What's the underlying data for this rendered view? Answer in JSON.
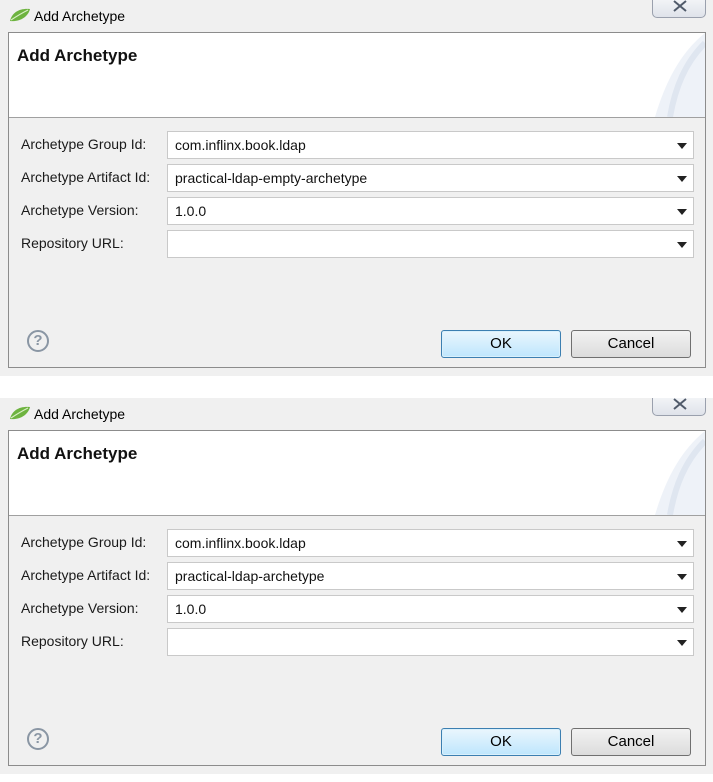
{
  "dialogs": [
    {
      "window_title": "Add Archetype",
      "banner_title": "Add Archetype",
      "fields": [
        {
          "label": "Archetype Group Id:",
          "value": "com.inflinx.book.ldap"
        },
        {
          "label": "Archetype Artifact Id:",
          "value": "practical-ldap-empty-archetype"
        },
        {
          "label": "Archetype Version:",
          "value": "1.0.0"
        },
        {
          "label": "Repository URL:",
          "value": ""
        }
      ],
      "help_glyph": "?",
      "ok_label": "OK",
      "cancel_label": "Cancel"
    },
    {
      "window_title": "Add Archetype",
      "banner_title": "Add Archetype",
      "fields": [
        {
          "label": "Archetype Group Id:",
          "value": "com.inflinx.book.ldap"
        },
        {
          "label": "Archetype Artifact Id:",
          "value": "practical-ldap-archetype"
        },
        {
          "label": "Archetype Version:",
          "value": "1.0.0"
        },
        {
          "label": "Repository URL:",
          "value": ""
        }
      ],
      "help_glyph": "?",
      "ok_label": "OK",
      "cancel_label": "Cancel"
    }
  ],
  "icons": {
    "app": "spring-leaf-icon",
    "close": "close-icon",
    "help": "help-icon",
    "dropdown": "chevron-down-icon"
  },
  "colors": {
    "ok_button_border": "#3c7fb1",
    "ok_button_fill": "#bee6fd",
    "app_icon": "#6db33f"
  }
}
